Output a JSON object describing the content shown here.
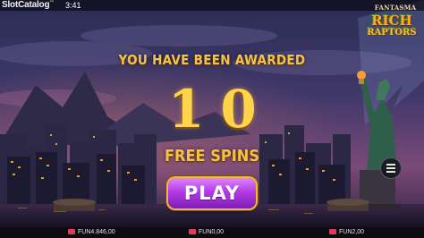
{
  "topbar": {
    "brand": "SlotCatalog",
    "brand_mark": "™",
    "clock": "3:41"
  },
  "publisher": "FANTASMA",
  "game_logo": {
    "line1": "RICH",
    "line2": "RAPTORS"
  },
  "award": {
    "headline": "YOU HAVE BEEN AWARDED",
    "count": "10",
    "label": "FREE SPINS",
    "play_label": "PLAY"
  },
  "menu": {
    "icon": "hamburger-menu-icon"
  },
  "statusbar": {
    "balance": "FUN4.846,00",
    "win": "FUN0,00",
    "bet": "FUN2,00"
  },
  "colors": {
    "accent_gold": "#f7c243",
    "play_purple": "#b23ae6",
    "icon_red": "#e23a5b"
  }
}
